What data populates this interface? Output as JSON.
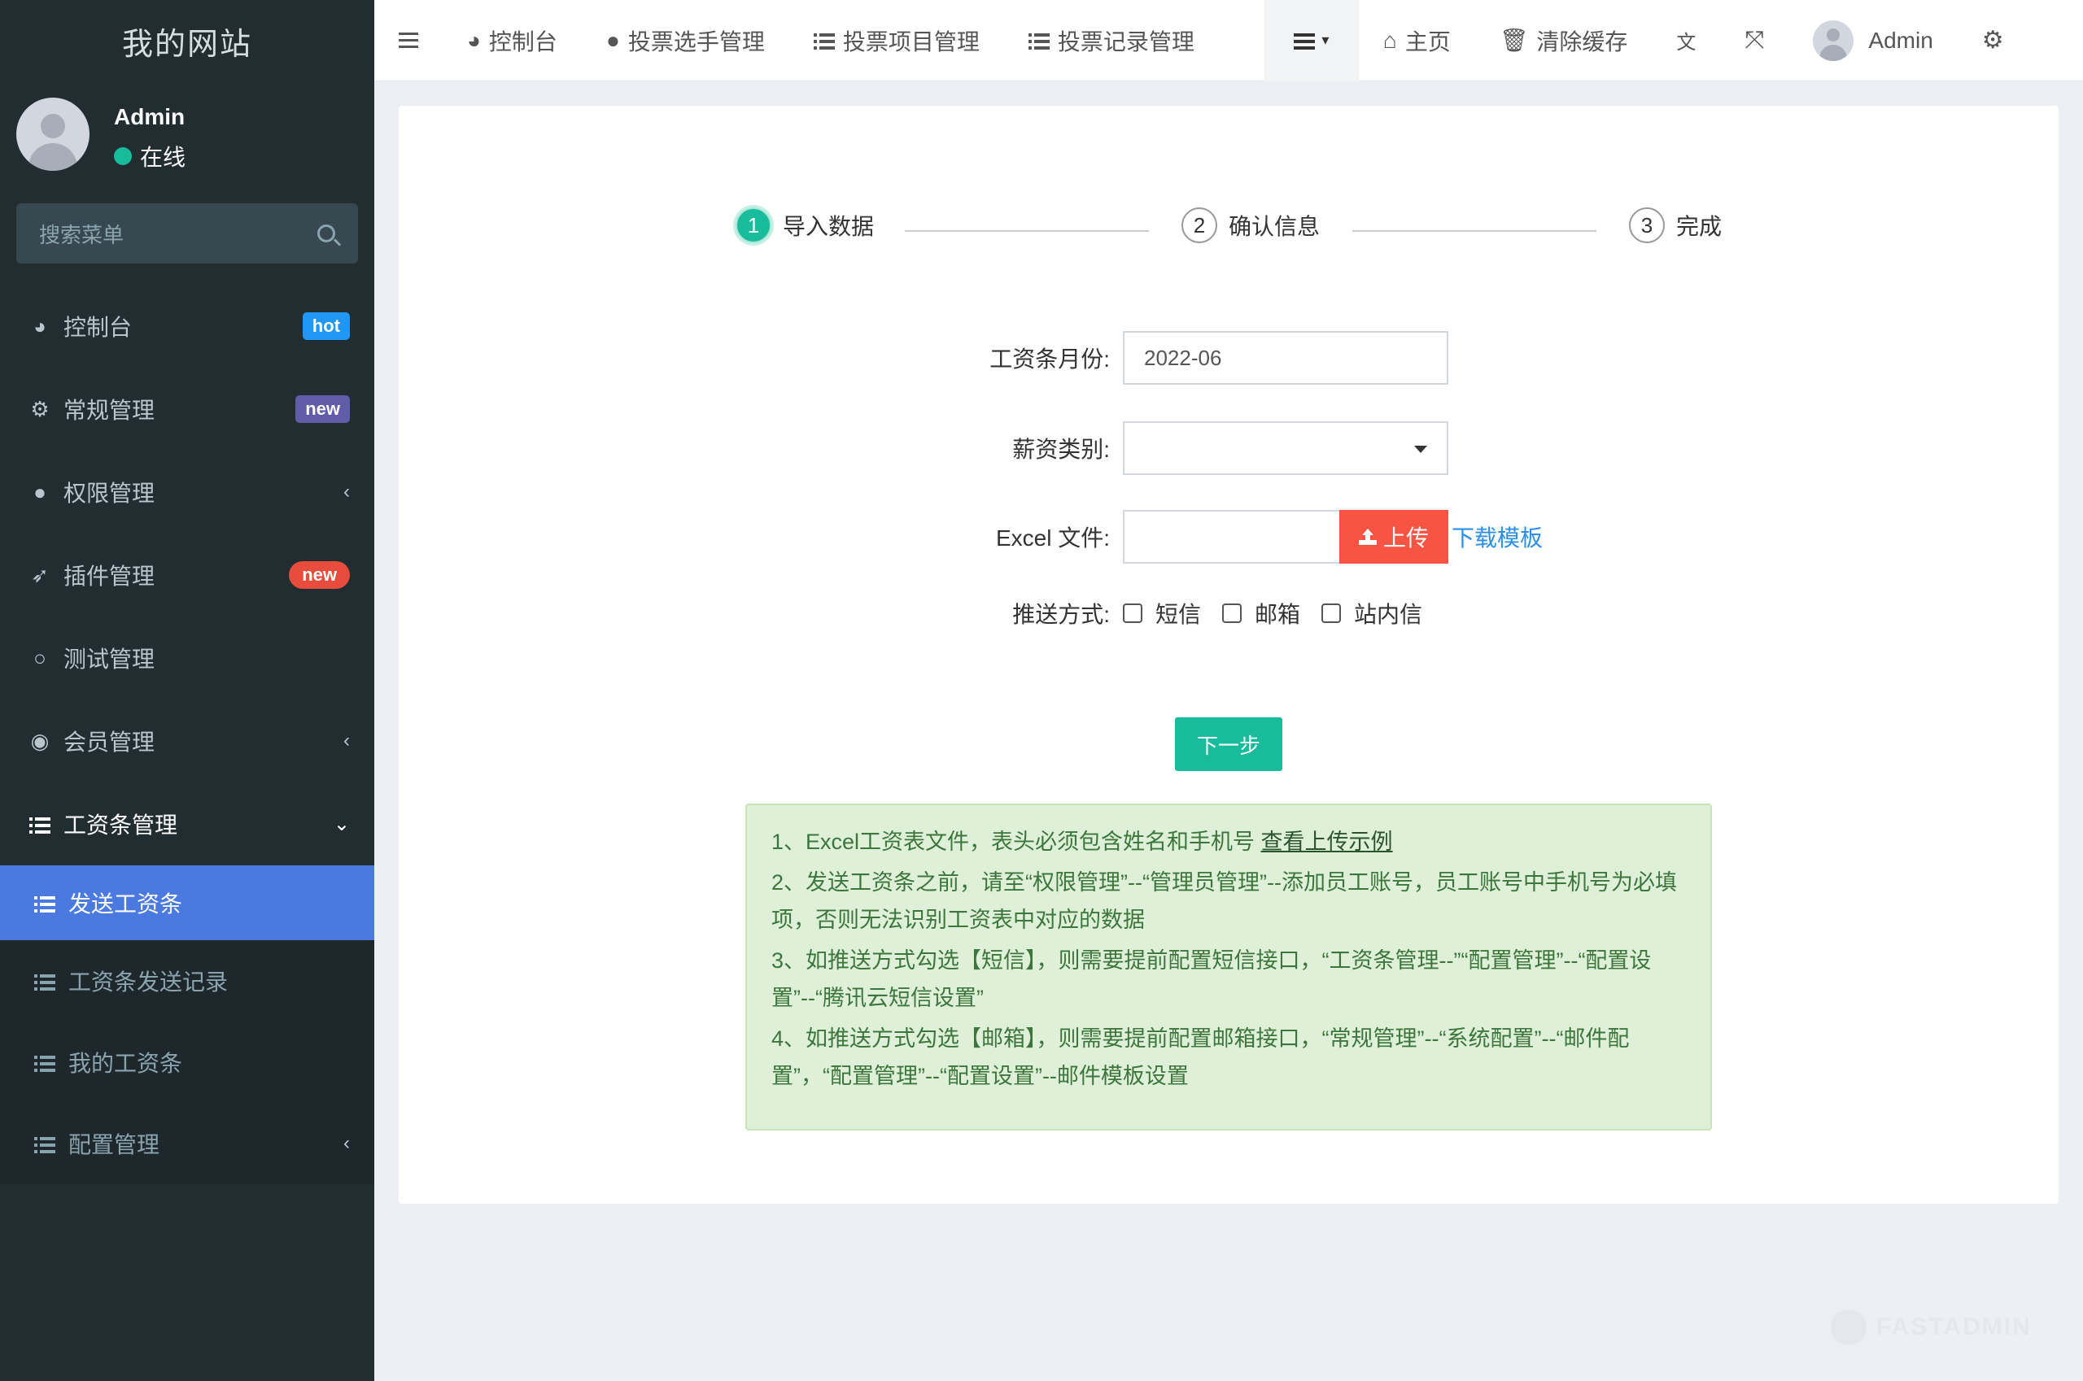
{
  "app": {
    "site_name": "我的网站",
    "user_name": "Admin",
    "user_status": "在线"
  },
  "sidebar": {
    "search_placeholder": "搜索菜单",
    "items": [
      {
        "label": "控制台",
        "badge": "hot"
      },
      {
        "label": "常规管理",
        "badge": "new"
      },
      {
        "label": "权限管理"
      },
      {
        "label": "插件管理",
        "badge": "new"
      },
      {
        "label": "测试管理"
      },
      {
        "label": "会员管理"
      },
      {
        "label": "工资条管理"
      }
    ],
    "sub_items": [
      {
        "label": "发送工资条"
      },
      {
        "label": "工资条发送记录"
      },
      {
        "label": "我的工资条"
      },
      {
        "label": "配置管理"
      }
    ]
  },
  "topbar": {
    "nav": [
      "控制台",
      "投票选手管理",
      "投票项目管理",
      "投票记录管理"
    ],
    "home": "主页",
    "clear_cache": "清除缓存",
    "user": "Admin"
  },
  "steps": [
    {
      "num": "1",
      "label": "导入数据"
    },
    {
      "num": "2",
      "label": "确认信息"
    },
    {
      "num": "3",
      "label": "完成"
    }
  ],
  "form": {
    "month_label": "工资条月份:",
    "month_value": "2022-06",
    "category_label": "薪资类别:",
    "file_label": "Excel 文件:",
    "upload_label": "上传",
    "download_label": "下载模板",
    "push_label": "推送方式:",
    "push_options": [
      "短信",
      "邮箱",
      "站内信"
    ],
    "next_label": "下一步"
  },
  "notice": {
    "line1": "1、Excel工资表文件，表头必须包含姓名和手机号 ",
    "line1_link": "查看上传示例",
    "line2": "2、发送工资条之前，请至“权限管理”--“管理员管理”--添加员工账号，员工账号中手机号为必填项，否则无法识别工资表中对应的数据",
    "line3": "3、如推送方式勾选【短信】，则需要提前配置短信接口，“工资条管理--”“配置管理”--“配置设置”--“腾讯云短信设置”",
    "line4": "4、如推送方式勾选【邮箱】，则需要提前配置邮箱接口，“常规管理”--“系统配置”--“邮件配置”，“配置管理”--“配置设置”--邮件模板设置"
  },
  "watermark": "FASTADMIN"
}
